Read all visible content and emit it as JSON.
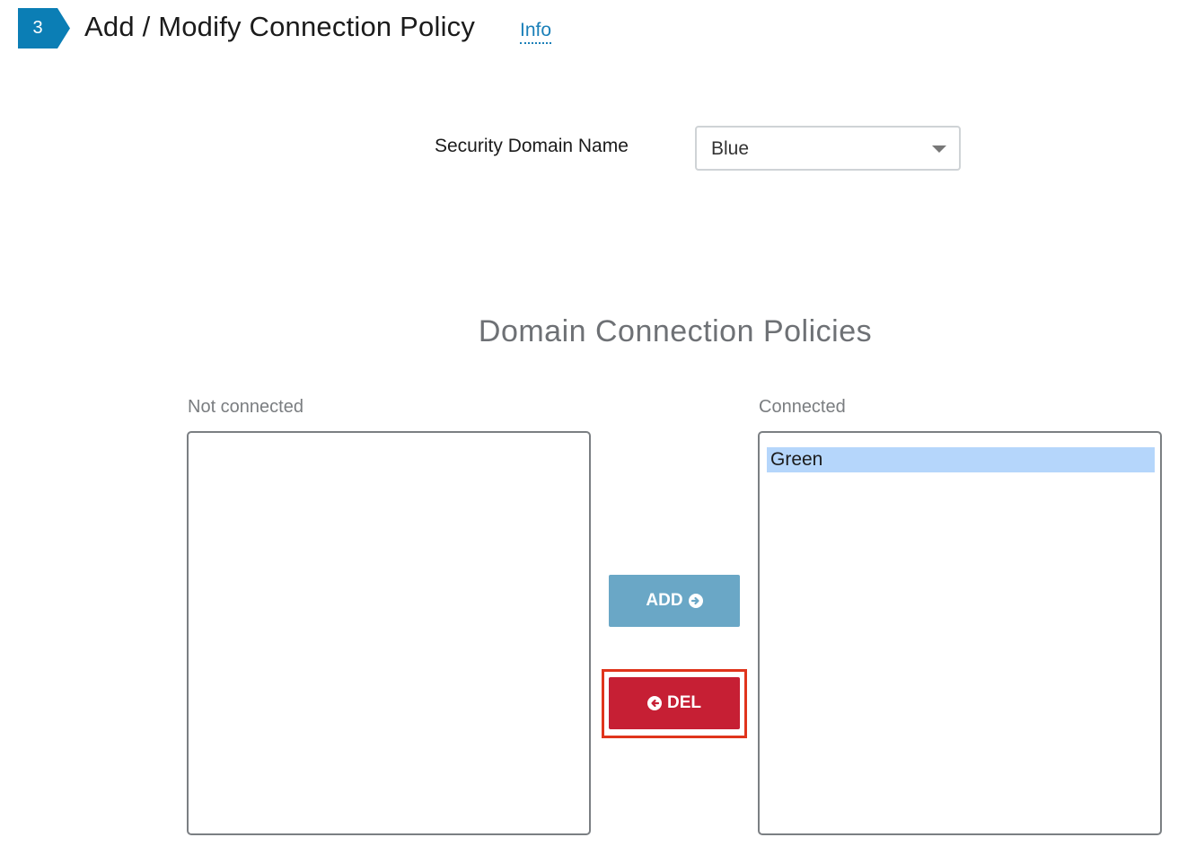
{
  "header": {
    "step_number": "3",
    "title": "Add / Modify Connection Policy",
    "info_link": "Info",
    "step_color": "#0b7eb5"
  },
  "security_domain": {
    "label": "Security Domain Name",
    "selected_value": "Blue"
  },
  "policies": {
    "title": "Domain Connection Policies",
    "not_connected": {
      "label": "Not connected",
      "items": []
    },
    "connected": {
      "label": "Connected",
      "items": [
        "Green"
      ],
      "selected_item": "Green"
    },
    "add_button": {
      "label": "ADD",
      "icon": "arrow-circle-right-icon",
      "color": "#6aa7c6"
    },
    "del_button": {
      "label": "DEL",
      "icon": "arrow-circle-left-icon",
      "color": "#c61f34",
      "highlighted": true
    }
  }
}
